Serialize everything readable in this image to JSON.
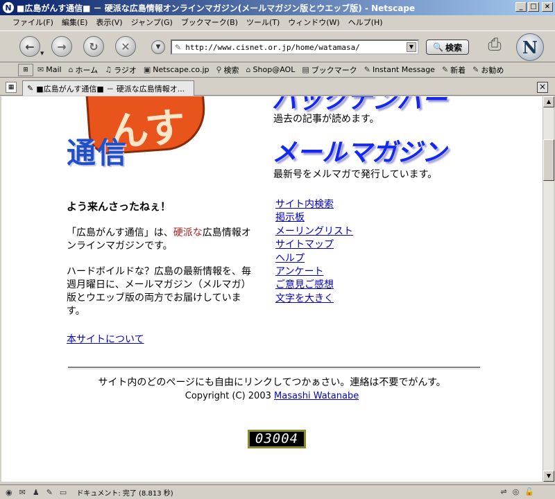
{
  "window": {
    "title": "■広島がんす通信■ － 硬派な広島情報オンラインマガジン(メールマガジン版とウエッブ版) - Netscape",
    "app_icon_letter": "N",
    "controls": [
      "_",
      "□",
      "×"
    ]
  },
  "menu": [
    "ファイル(F)",
    "編集(E)",
    "表示(V)",
    "ジャンプ(G)",
    "ブックマーク(B)",
    "ツール(T)",
    "ウィンドウ(W)",
    "ヘルプ(H)"
  ],
  "navbar": {
    "url": "http://www.cisnet.or.jp/home/watamasa/",
    "search_label": "検索",
    "logo_letter": "N"
  },
  "personal_toolbar": [
    {
      "icon": "mail-icon",
      "label": "Mail"
    },
    {
      "icon": "home-icon",
      "label": "ホーム"
    },
    {
      "icon": "radio-icon",
      "label": "ラジオ"
    },
    {
      "icon": "my-icon",
      "label": "Netscape.co.jp"
    },
    {
      "icon": "search-icon",
      "label": "検索"
    },
    {
      "icon": "shop-icon",
      "label": "Shop@AOL"
    },
    {
      "icon": "folder-icon",
      "label": "ブックマーク"
    },
    {
      "icon": "link-icon",
      "label": "Instant Message"
    },
    {
      "icon": "link-icon",
      "label": "新着"
    },
    {
      "icon": "link-icon",
      "label": "お勧め"
    }
  ],
  "tab": {
    "label": "■広島がんす通信■ － 硬派な広島情報オ..."
  },
  "page": {
    "logo_big": "んす",
    "logo_sub": "通信",
    "heading_top": "バックナンバー",
    "text_top": "過去の記事が読めます。",
    "heading_mail": "メールマガジン",
    "text_mail": "最新号をメルマガで発行しています。",
    "welcome": "よう来んさったねぇ！",
    "intro1_a": "「広島がんす通信」は、",
    "intro1_red": "硬派な",
    "intro1_b": "広島情報オンラインマガジンです。",
    "intro2": "ハードボイルドな？広島の最新情報を、毎週月曜日に、メールマガジン（メルマガ）版とウエッブ版の両方でお届けしています。",
    "about_link": "本サイトについて",
    "links": [
      "サイト内検索",
      "掲示板",
      "メーリングリスト",
      "サイトマップ",
      "ヘルプ",
      "アンケート",
      "ご意見ご感想",
      "文字を大きく"
    ],
    "footer_line": "サイト内のどのページにも自由にリンクしてつかぁさい。連絡は不要でがんす。",
    "copyright": "Copyright (C) 2003",
    "author": "Masashi Watanabe",
    "counter": "03004"
  },
  "status": {
    "text": "ドキュメント: 完了 (8.813 秒)"
  },
  "colors": {
    "link": "#0000cc",
    "heading_blue": "#1428f0",
    "logo_orange": "#e8541c",
    "accent_red": "#b02020"
  }
}
